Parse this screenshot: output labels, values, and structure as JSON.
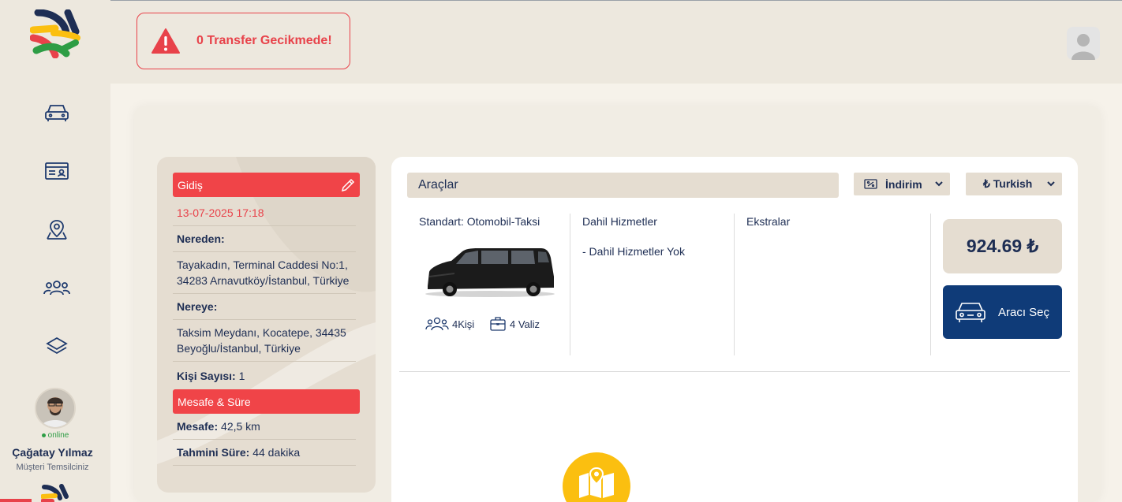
{
  "alert": {
    "text": "0 Transfer Gecikmede!"
  },
  "user": {
    "status": "online",
    "name": "Çağatay Yılmaz",
    "role": "Müşteri Temsilciniz"
  },
  "trip": {
    "departure_header": "Gidiş",
    "datetime": "13-07-2025 17:18",
    "from_label": "Nereden:",
    "from_address": "Tayakadın, Terminal Caddesi No:1, 34283 Arnavutköy/İstanbul, Türkiye",
    "to_label": "Nereye:",
    "to_address": "Taksim Meydanı, Kocatepe, 34435 Beyoğlu/İstanbul, Türkiye",
    "passenger_label": "Kişi Sayısı:",
    "passenger_count": "1",
    "distance_header": "Mesafe & Süre",
    "distance_label": "Mesafe:",
    "distance_value": "42,5 km",
    "duration_label": "Tahmini Süre:",
    "duration_value": "44 dakika"
  },
  "vehicles": {
    "header": "Araçlar",
    "discount_select": "İndirim",
    "currency_select": "₺ Turkish",
    "vehicle_name": "Standart: Otomobil-Taksi",
    "persons": "4Kişi",
    "luggage": "4 Valiz",
    "included_title": "Dahil Hizmetler",
    "included_item": "- Dahil Hizmetler Yok",
    "extras_title": "Ekstralar",
    "price": "924.69 ₺",
    "select_button": "Aracı Seç"
  },
  "colors": {
    "accent_red": "#e8424a",
    "navy": "#0f3b78",
    "yellow": "#fbbf10",
    "beige": "#e5ddd1"
  }
}
